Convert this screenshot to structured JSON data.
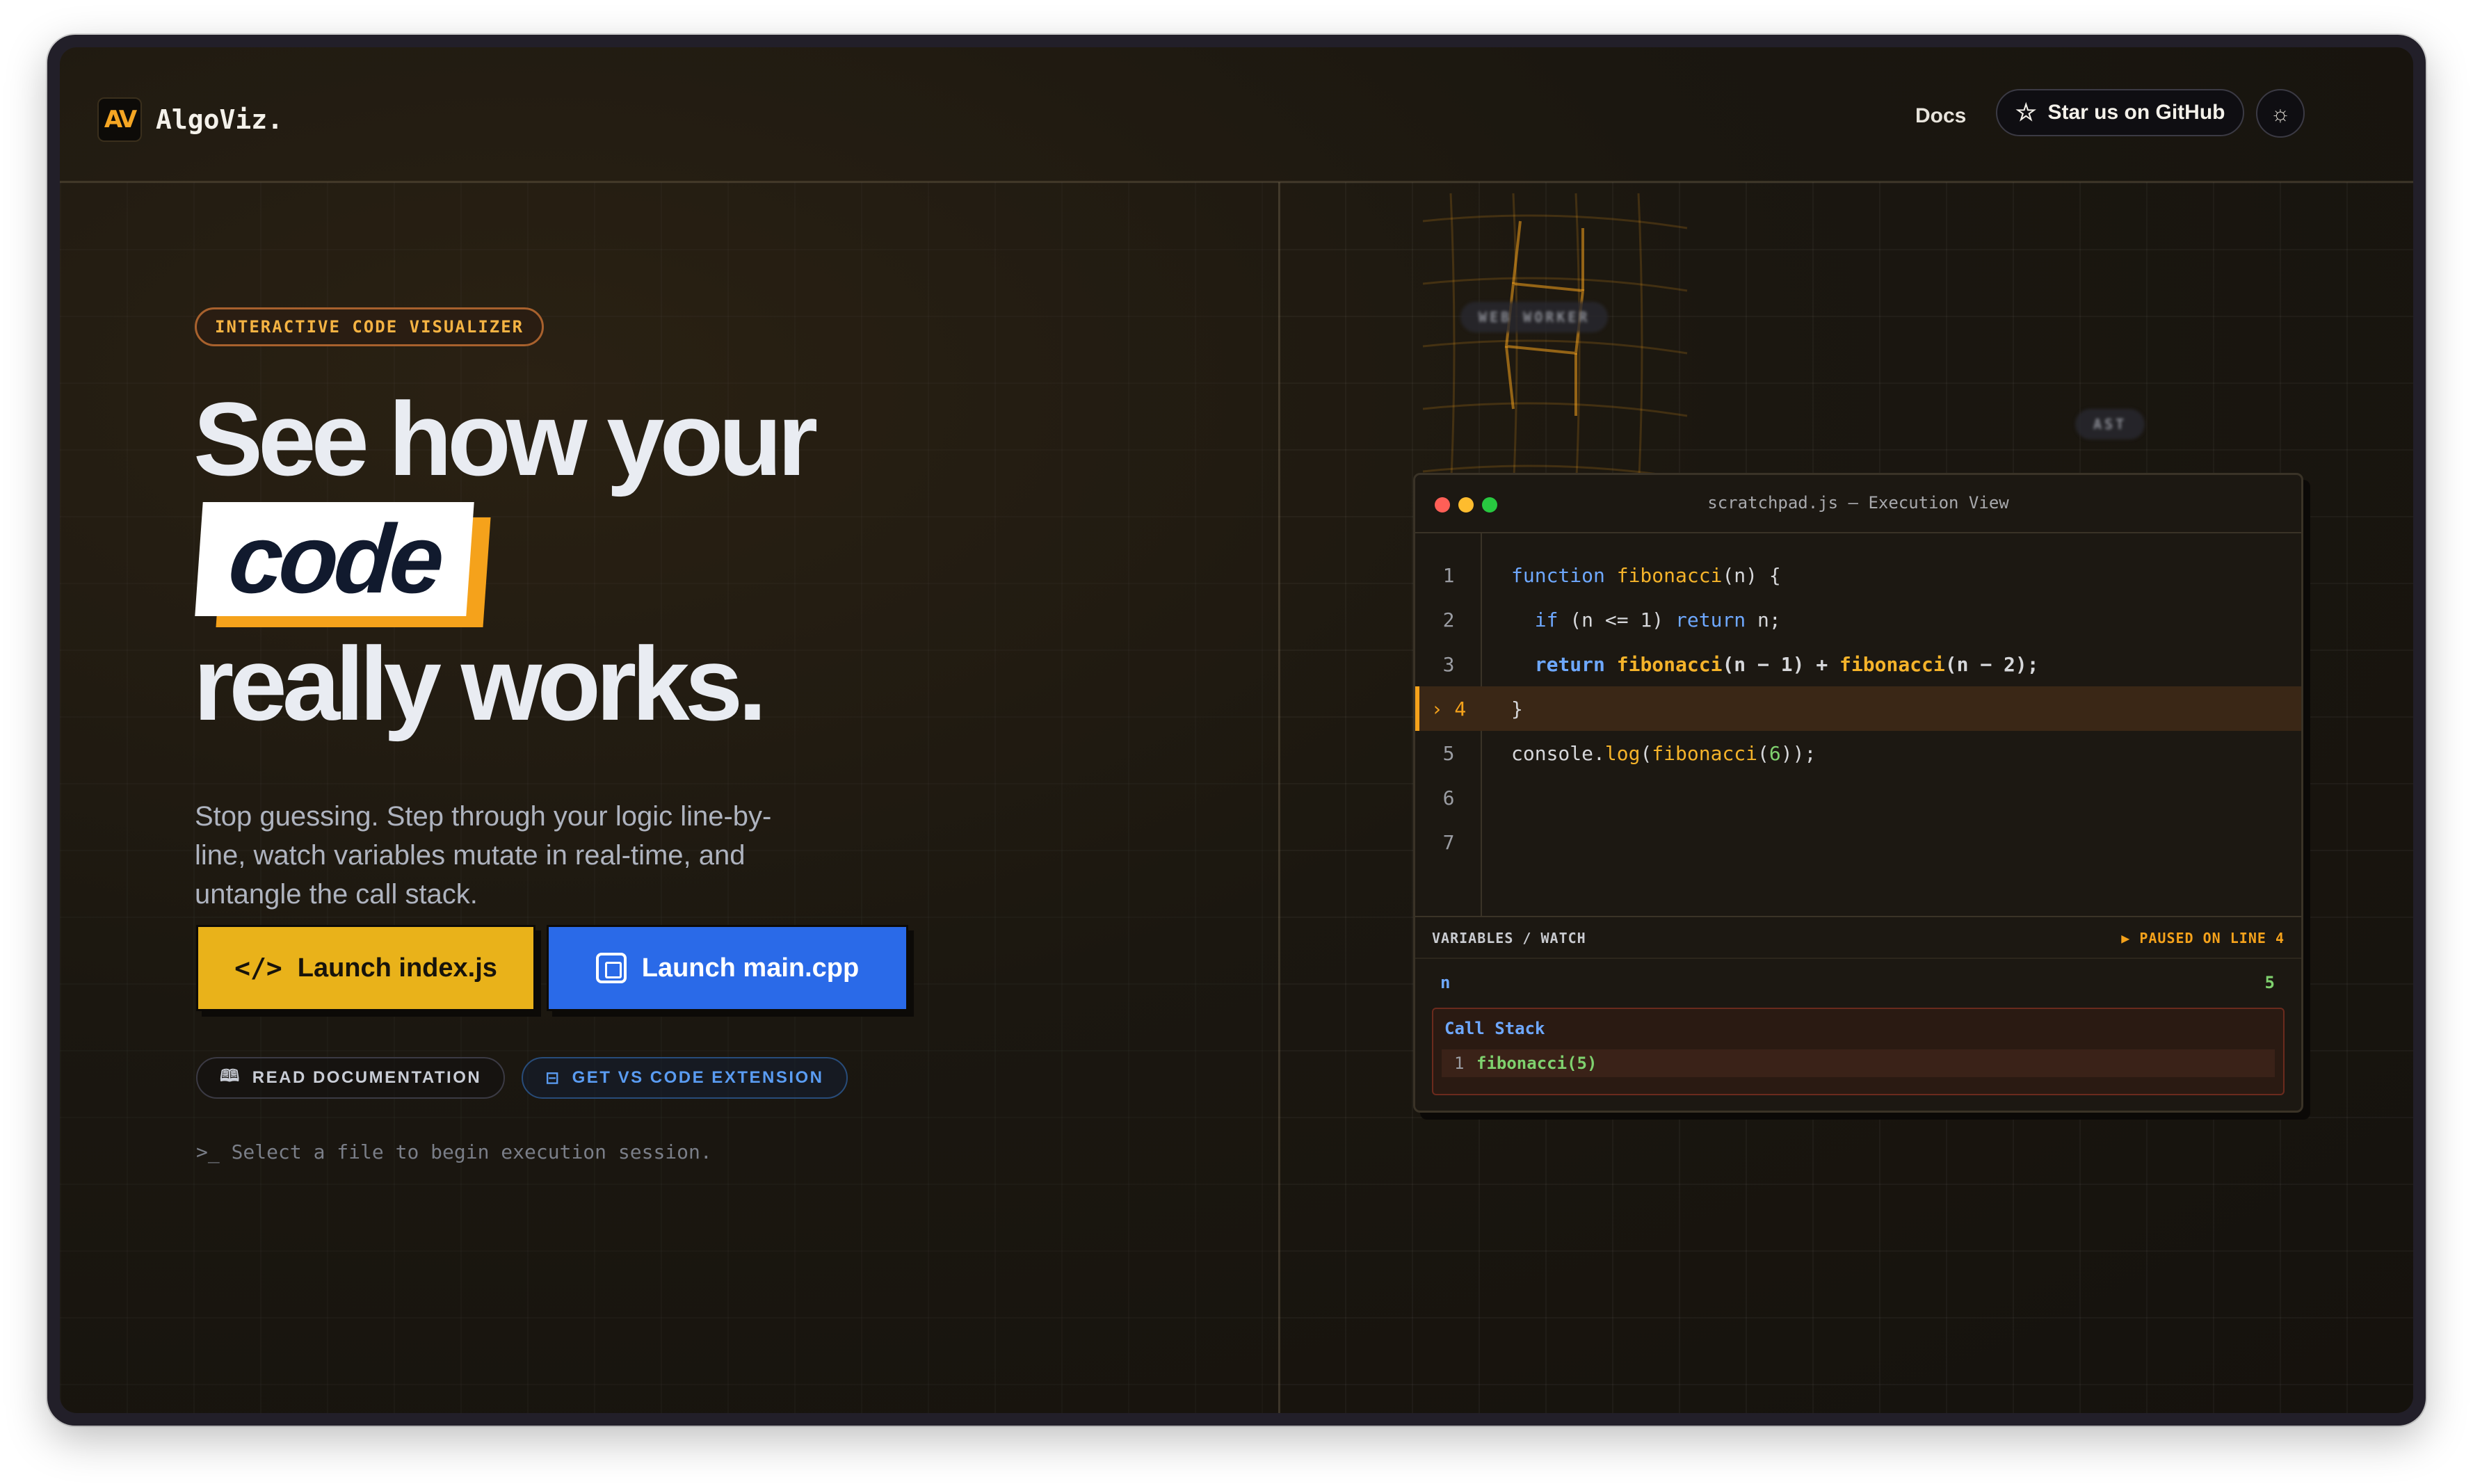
{
  "nav": {
    "logo_mark": "AV",
    "brand": "AlgoViz.",
    "docs_label": "Docs",
    "star_label": "Star us on GitHub"
  },
  "hero": {
    "badge": "INTERACTIVE CODE VISUALIZER",
    "headline_line1": "See how your",
    "headline_highlight": "code",
    "headline_line3": "really works.",
    "lede": "Stop guessing. Step through your logic line-by-line, watch variables mutate in real-time, and untangle the call stack.",
    "btn_js": "Launch index.js",
    "btn_cpp": "Launch main.cpp",
    "pill_docs": "READ DOCUMENTATION",
    "pill_ext": "GET VS CODE EXTENSION",
    "hint": "Select a file to begin execution session."
  },
  "floating_labels": [
    "WEB WORKER",
    "AST"
  ],
  "editor": {
    "title": "scratchpad.js — Execution View",
    "active_line": 4,
    "lines": [
      {
        "n": "1"
      },
      {
        "n": "2"
      },
      {
        "n": "3"
      },
      {
        "n": "4"
      },
      {
        "n": "5"
      },
      {
        "n": "6"
      },
      {
        "n": "7"
      }
    ],
    "panel_label": "VARIABLES / WATCH",
    "status": "PAUSED ON LINE 4",
    "variables": [
      {
        "name": "n",
        "value": "5"
      }
    ],
    "callstack_title": "Call Stack",
    "callstack": [
      {
        "index": "1",
        "frame": "fibonacci(5)"
      }
    ]
  },
  "colors": {
    "accent": "#f5a21b",
    "primary_blue": "#2a6ae8",
    "cta_yellow": "#e9b21a",
    "keyword": "#6ea8ff",
    "function": "#f5b32a",
    "number": "#7fd16e"
  }
}
